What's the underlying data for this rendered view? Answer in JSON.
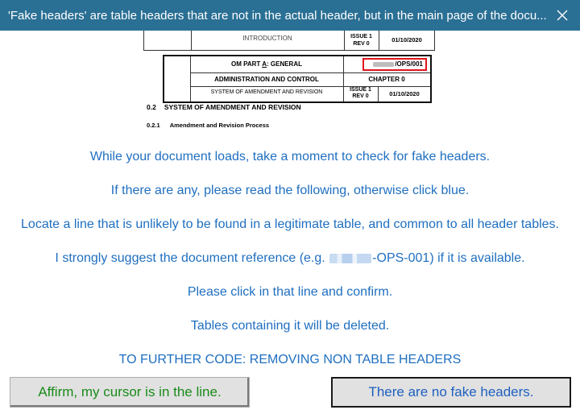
{
  "window": {
    "title": "'Fake headers' are table headers that are not in the actual header, but in the main page of the docu..."
  },
  "preview": {
    "table1": {
      "title": "INTRODUCTION",
      "issue": "ISSUE 1",
      "rev": "REV 0",
      "date": "01/10/2020"
    },
    "table2": {
      "part_prefix": "OM PART ",
      "part_letter": "A",
      "part_suffix": ": GENERAL",
      "doc_ref": "/OPS/001",
      "section": "ADMINISTRATION AND CONTROL",
      "chapter": "CHAPTER 0",
      "subsection": "SYSTEM OF AMENDMENT AND REVISION",
      "issue": "ISSUE 1",
      "rev": "REV 0",
      "date": "01/10/2020"
    },
    "heading1_num": "0.2",
    "heading1_text": "SYSTEM OF AMENDMENT AND REVISION",
    "heading2_num": "0.2.1",
    "heading2_text": "Amendment and Revision Process"
  },
  "messages": {
    "line1": "While your document loads, take a moment to check for fake headers.",
    "line2": "If there are any, please read the following, otherwise click blue.",
    "line3": "Locate a line that is unlikely to be found in a legitimate table, and common to all header tables.",
    "line4_before": "I strongly suggest the document reference (e.g. ",
    "line4_after": "-OPS-001) if it is available.",
    "line5": "Please click in that line and confirm.",
    "line6": "Tables containing it will be deleted.",
    "line7": "TO FURTHER CODE: REMOVING NON TABLE HEADERS"
  },
  "buttons": {
    "affirm": "Affirm, my cursor is in the line.",
    "no_fake": "There are no fake headers."
  },
  "colors": {
    "titlebar": "#2a6f94",
    "message_text": "#1f6fc0",
    "affirm_text": "#1a8a1a",
    "no_fake_text": "#1f5fbf",
    "highlight_box": "#e0141e"
  },
  "icons": {
    "close": "close-icon"
  }
}
